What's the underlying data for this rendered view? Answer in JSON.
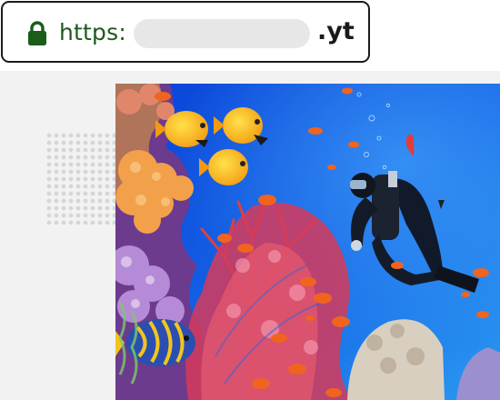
{
  "browser": {
    "scheme": "https:",
    "domain_masked": "",
    "tld": ".yt",
    "lock_icon": "padlock-icon",
    "lock_color": "#1a5c1a"
  },
  "image": {
    "subject": "underwater-coral-reef-scene",
    "palette": {
      "water_deep": "#0a3fd6",
      "water_light": "#1f8cf0",
      "coral_red": "#d9342f",
      "fish_yellow": "#f7c21b",
      "fish_orange": "#f0641f"
    }
  }
}
